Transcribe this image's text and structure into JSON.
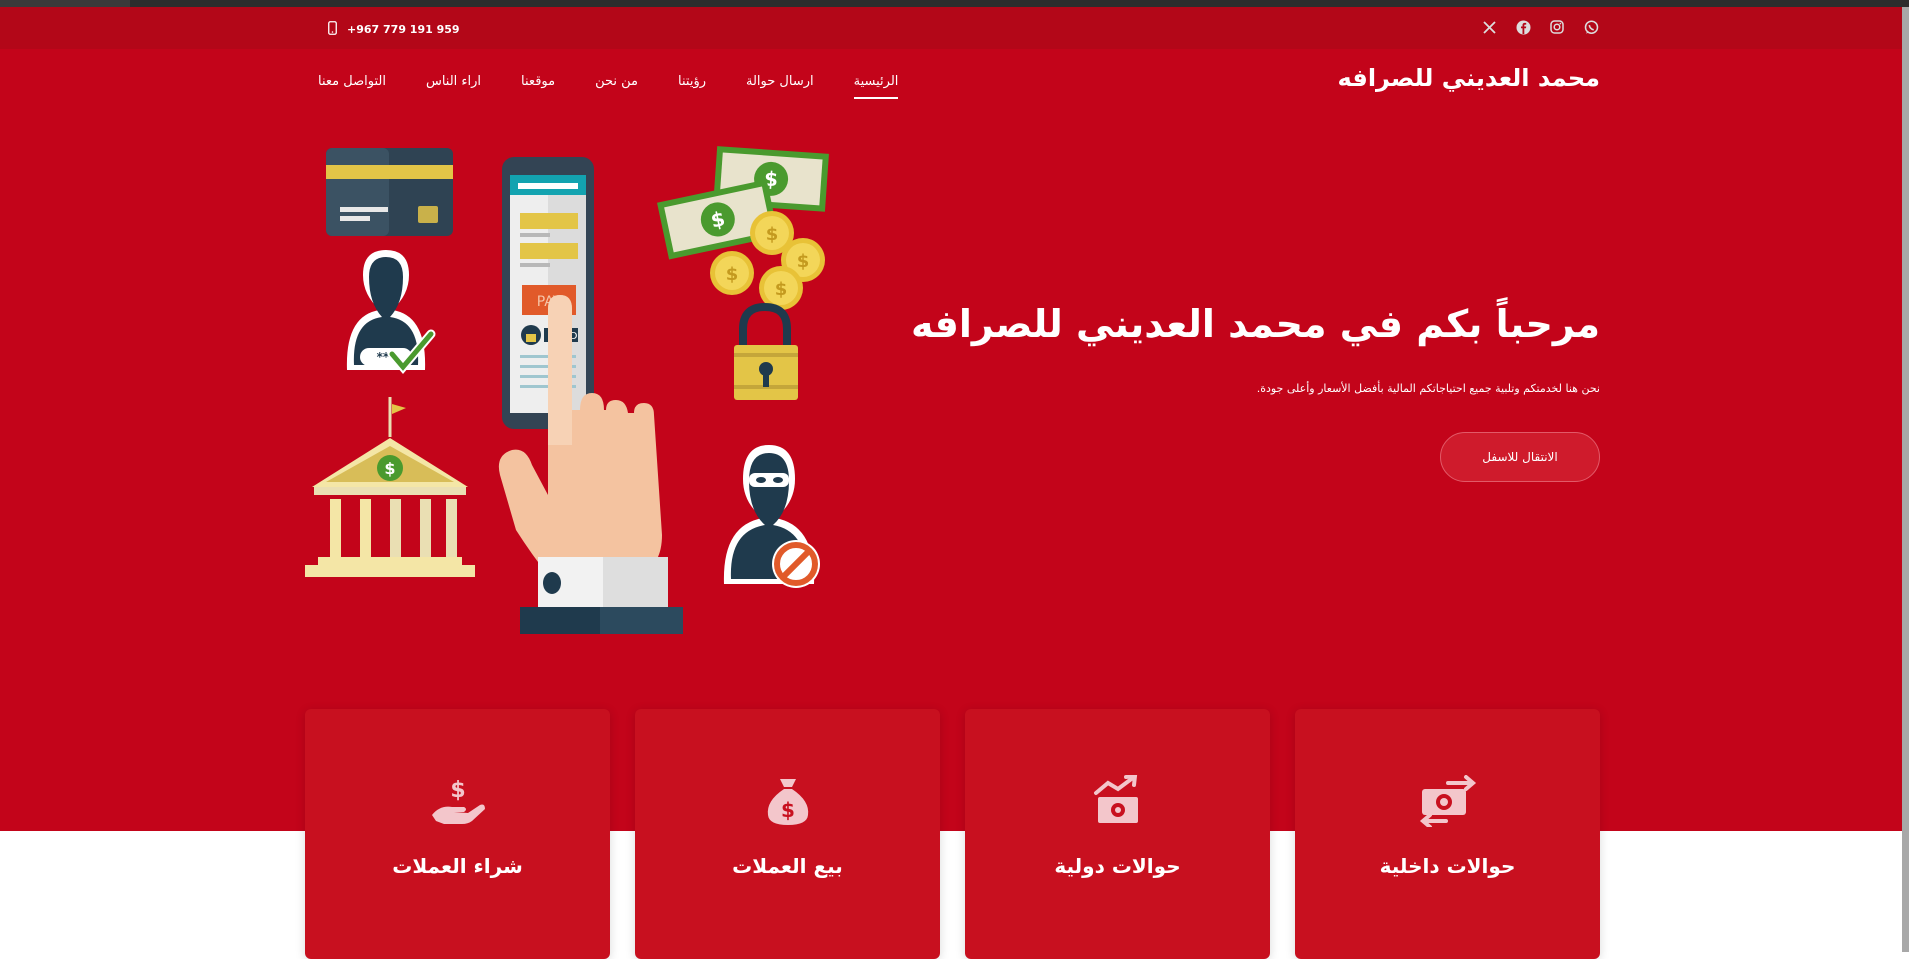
{
  "topbar": {
    "phone": "+967 779 191 959",
    "phone_icon": "mobile-phone-icon",
    "socials": [
      "whatsapp-icon",
      "instagram-icon",
      "facebook-icon",
      "x-icon"
    ]
  },
  "header": {
    "brand": "محمد العديني للصرافه",
    "nav": [
      {
        "label": "الرئيسية",
        "active": true
      },
      {
        "label": "ارسال حوالة",
        "active": false
      },
      {
        "label": "رؤيتنا",
        "active": false
      },
      {
        "label": "من نحن",
        "active": false
      },
      {
        "label": "موقعنا",
        "active": false
      },
      {
        "label": "اراء الناس",
        "active": false
      },
      {
        "label": "التواصل معنا",
        "active": false
      }
    ]
  },
  "hero": {
    "title": "مرحباً بكم في محمد العديني للصرافه",
    "subtitle": "نحن هنا لخدمتكم وتلبية جميع احتياجاتكم المالية بأفضل الأسعار وأعلى جودة.",
    "cta": "الانتقال للاسفل",
    "illustration_text": {
      "pay": "PAY",
      "red": "RED",
      "stars": "***"
    }
  },
  "services": [
    {
      "label": "حوالات داخلية",
      "icon": "money-transfer-icon"
    },
    {
      "label": "حوالات دولية",
      "icon": "money-growth-icon"
    },
    {
      "label": "بيع العملات",
      "icon": "money-bag-icon"
    },
    {
      "label": "شراء العملات",
      "icon": "hand-dollar-icon"
    }
  ],
  "colors": {
    "primary": "#c3041a",
    "topbar": "#b30718",
    "card": "#c8101f"
  }
}
